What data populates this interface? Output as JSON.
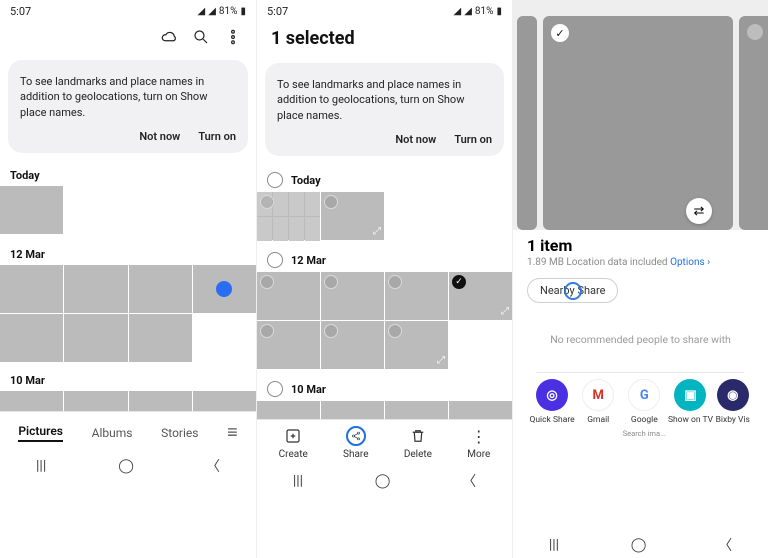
{
  "status": {
    "time": "5:07",
    "battery": "81%"
  },
  "banner": {
    "text": "To see landmarks and place names in addition to geolocations, turn on Show place names.",
    "notnow": "Not now",
    "turnon": "Turn on"
  },
  "screen1": {
    "dates": {
      "d0": "Today",
      "d1": "12 Mar",
      "d2": "10 Mar"
    },
    "tabs": {
      "pictures": "Pictures",
      "albums": "Albums",
      "stories": "Stories"
    }
  },
  "screen2": {
    "title": "1 selected",
    "dates": {
      "d0": "Today",
      "d1": "12 Mar",
      "d2": "10 Mar"
    },
    "actions": {
      "create": "Create",
      "share": "Share",
      "delete": "Delete",
      "more": "More"
    }
  },
  "screen3": {
    "title": "1 item",
    "subtitle": "1.89 MB Location data included",
    "options": "Options",
    "chip": "Nearby Share",
    "msg": "No recommended people to share with",
    "apps": {
      "a0": {
        "label": "Quick Share"
      },
      "a1": {
        "label": "Gmail"
      },
      "a2": {
        "label": "Google",
        "sub": "Search ima..."
      },
      "a3": {
        "label": "Show on TV"
      },
      "a4": {
        "label": "Bixby Vis"
      }
    }
  },
  "glyphs": {
    "checkmark": "✓",
    "caret": "›",
    "options_caret": " ›",
    "recent": "|||",
    "home": "◯",
    "back": "〈",
    "signal1": "◢",
    "signal2": "◢",
    "batt": "▮",
    "swap": "⇄",
    "expand": "⤢",
    "more_dots": "⋮",
    "burger": "≡"
  }
}
